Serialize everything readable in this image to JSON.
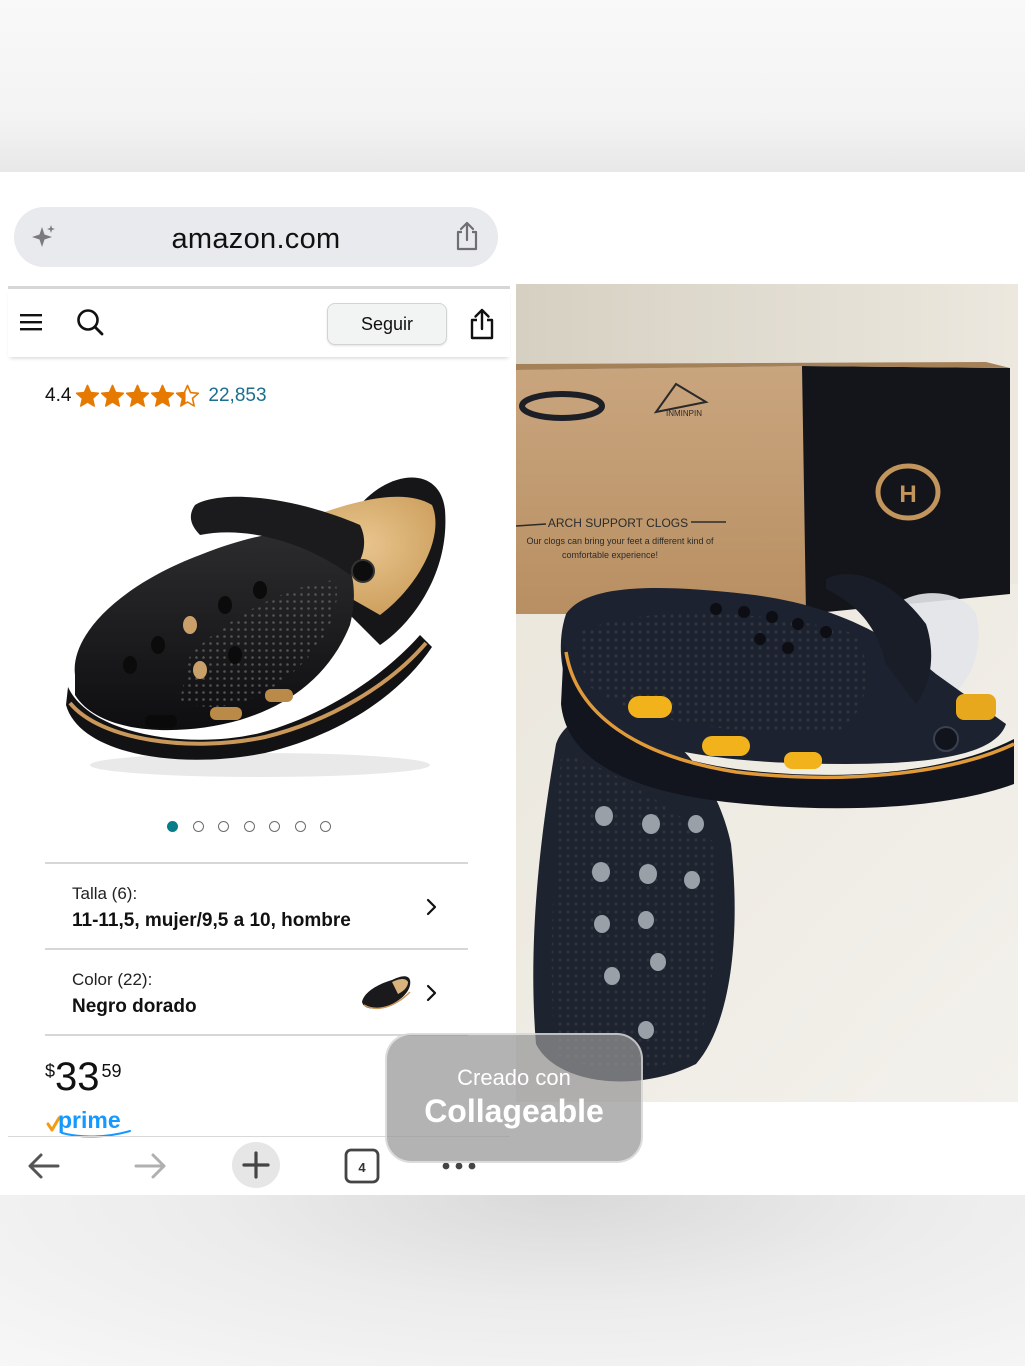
{
  "browser": {
    "url": "amazon.com",
    "tab_count": "4"
  },
  "nav": {
    "follow_label": "Seguir"
  },
  "product": {
    "rating_value": "4.4",
    "rating_stars": 4.4,
    "review_count": "22,853",
    "image_count": 7,
    "active_image_index": 0,
    "size_label": "Talla (6):",
    "size_value": "11-11,5, mujer/9,5 a 10, hombre",
    "color_label": "Color (22):",
    "color_value": "Negro dorado",
    "price_symbol": "$",
    "price_whole": "33",
    "price_fraction": "59",
    "prime_label": "prime"
  },
  "photo": {
    "box_heading": "ARCH SUPPORT CLOGS",
    "box_text_line1": "Our clogs can bring your feet a different kind of",
    "box_text_line2": "comfortable experience!",
    "box_brand": "INMINPIN"
  },
  "watermark": {
    "line1": "Creado con",
    "line2": "Collageable"
  },
  "colors": {
    "star": "#e67a00",
    "link": "#1a6e8f",
    "dot_active": "#077d8a",
    "prime": "#1399ff",
    "prime_check": "#f39c12"
  }
}
